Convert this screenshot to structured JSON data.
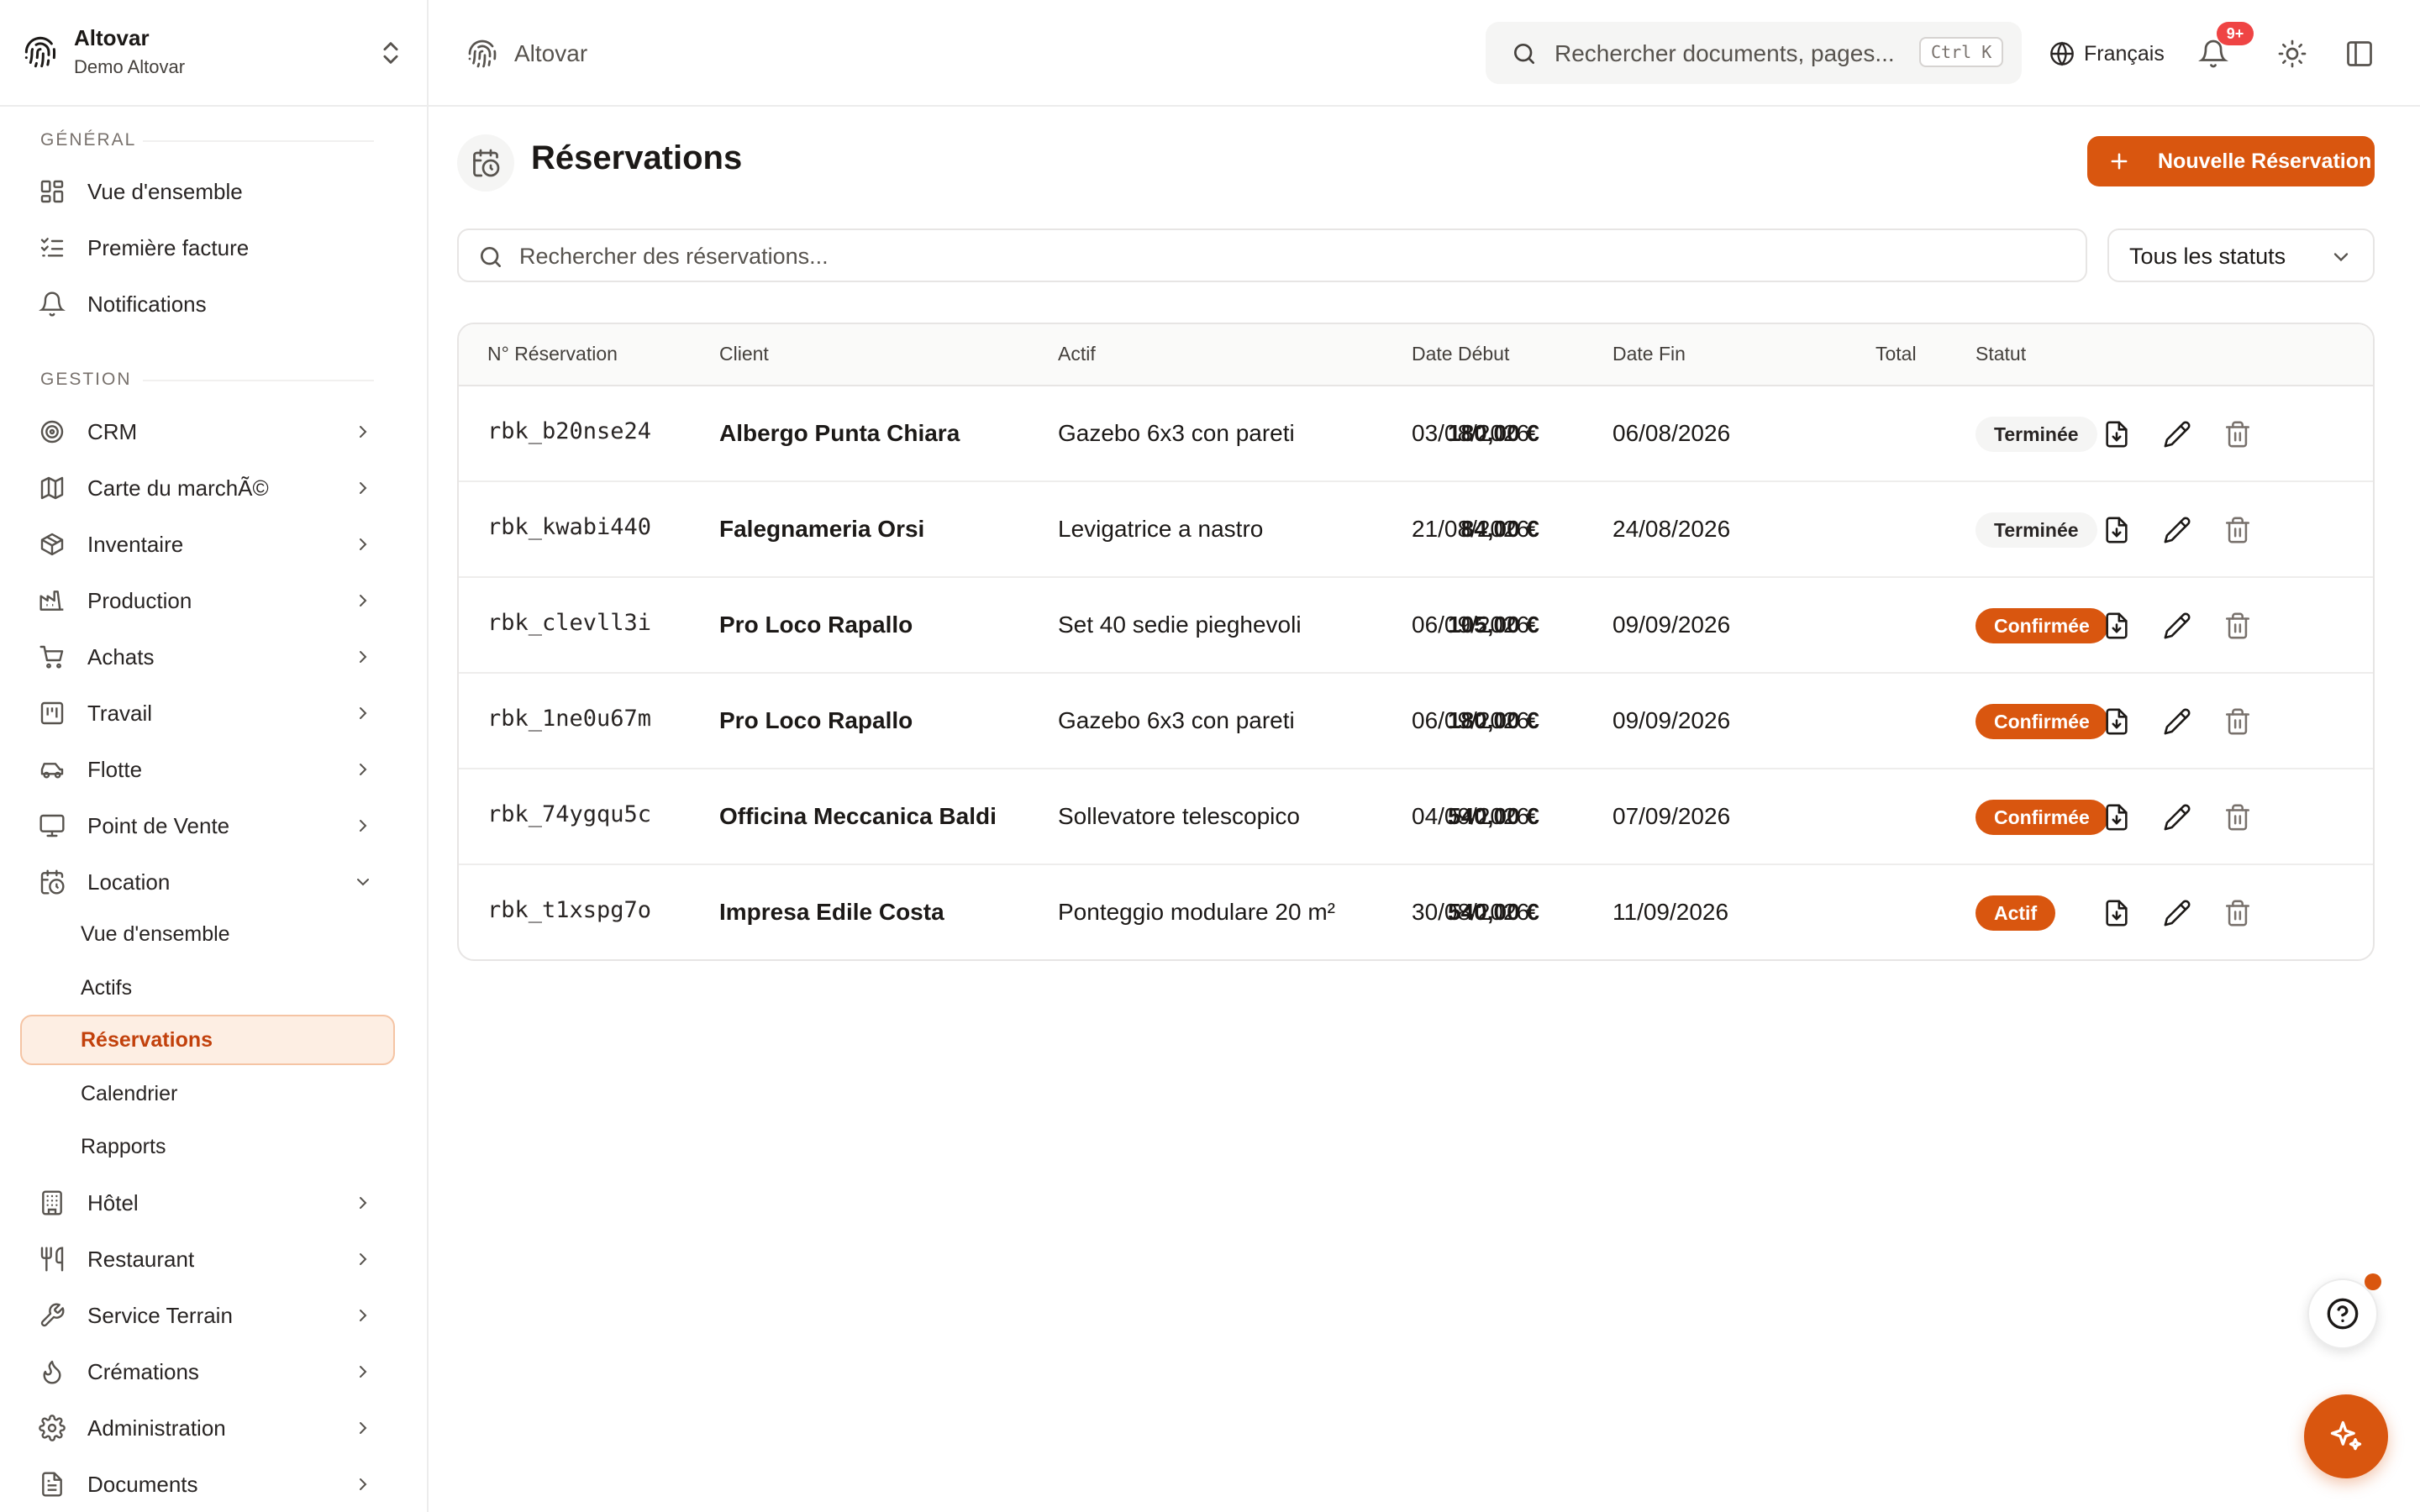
{
  "workspace": {
    "name": "Altovar",
    "subtitle": "Demo Altovar"
  },
  "topbar": {
    "title": "Altovar",
    "search_placeholder": "Rechercher documents, pages...",
    "search_shortcut": "Ctrl K",
    "language": "Français",
    "notifications_badge": "9+"
  },
  "sidebar": {
    "general_label": "GÉNÉRAL",
    "general_items": [
      {
        "label": "Vue d'ensemble",
        "icon": "dashboard-icon"
      },
      {
        "label": "Première facture",
        "icon": "checklist-icon"
      },
      {
        "label": "Notifications",
        "icon": "bell-icon"
      }
    ],
    "gestion_label": "GESTION",
    "gestion_items": [
      {
        "label": "CRM",
        "icon": "target-icon"
      },
      {
        "label": "Carte du marchÃ©",
        "icon": "map-icon"
      },
      {
        "label": "Inventaire",
        "icon": "box-icon"
      },
      {
        "label": "Production",
        "icon": "factory-icon"
      },
      {
        "label": "Achats",
        "icon": "cart-icon"
      },
      {
        "label": "Travail",
        "icon": "board-icon"
      },
      {
        "label": "Flotte",
        "icon": "car-icon"
      },
      {
        "label": "Point de Vente",
        "icon": "monitor-icon"
      },
      {
        "label": "Location",
        "icon": "calendar-clock-icon",
        "expanded": true
      }
    ],
    "location_sub": [
      {
        "label": "Vue d'ensemble"
      },
      {
        "label": "Actifs"
      },
      {
        "label": "Réservations",
        "active": true
      },
      {
        "label": "Calendrier"
      },
      {
        "label": "Rapports"
      }
    ],
    "after_items": [
      {
        "label": "Hôtel",
        "icon": "building-icon"
      },
      {
        "label": "Restaurant",
        "icon": "utensils-icon"
      },
      {
        "label": "Service Terrain",
        "icon": "wrench-icon"
      },
      {
        "label": "Crémations",
        "icon": "flame-icon"
      },
      {
        "label": "Administration",
        "icon": "gear-icon"
      },
      {
        "label": "Documents",
        "icon": "document-icon"
      }
    ]
  },
  "page": {
    "title": "Réservations",
    "new_button": "Nouvelle Réservation",
    "search_placeholder": "Rechercher des réservations...",
    "status_filter": "Tous les statuts"
  },
  "table": {
    "columns": [
      "N° Réservation",
      "Client",
      "Actif",
      "Date Début",
      "Date Fin",
      "Total",
      "Statut"
    ],
    "rows": [
      {
        "id": "rbk_b20nse24",
        "client": "Albergo Punta Chiara",
        "asset": "Gazebo 6x3 con pareti",
        "start": "03/08/2026",
        "end": "06/08/2026",
        "total": "180,00 €",
        "status": "Terminée",
        "status_kind": "done"
      },
      {
        "id": "rbk_kwabi440",
        "client": "Falegnameria Orsi",
        "asset": "Levigatrice a nastro",
        "start": "21/08/2026",
        "end": "24/08/2026",
        "total": "84,00 €",
        "status": "Terminée",
        "status_kind": "done"
      },
      {
        "id": "rbk_clevll3i",
        "client": "Pro Loco Rapallo",
        "asset": "Set 40 sedie pieghevoli",
        "start": "06/09/2026",
        "end": "09/09/2026",
        "total": "105,00 €",
        "status": "Confirmée",
        "status_kind": "conf"
      },
      {
        "id": "rbk_1ne0u67m",
        "client": "Pro Loco Rapallo",
        "asset": "Gazebo 6x3 con pareti",
        "start": "06/09/2026",
        "end": "09/09/2026",
        "total": "180,00 €",
        "status": "Confirmée",
        "status_kind": "conf"
      },
      {
        "id": "rbk_74ygqu5c",
        "client": "Officina Meccanica Baldi",
        "asset": "Sollevatore telescopico",
        "start": "04/09/2026",
        "end": "07/09/2026",
        "total": "540,00 €",
        "status": "Confirmée",
        "status_kind": "conf"
      },
      {
        "id": "rbk_t1xspg7o",
        "client": "Impresa Edile Costa",
        "asset": "Ponteggio modulare 20 m²",
        "start": "30/08/2026",
        "end": "11/09/2026",
        "total": "540,00 €",
        "status": "Actif",
        "status_kind": "act"
      }
    ]
  },
  "colors": {
    "accent": "#d9560f",
    "active_bg": "#fdeee3",
    "badge_red": "#ef4444"
  }
}
